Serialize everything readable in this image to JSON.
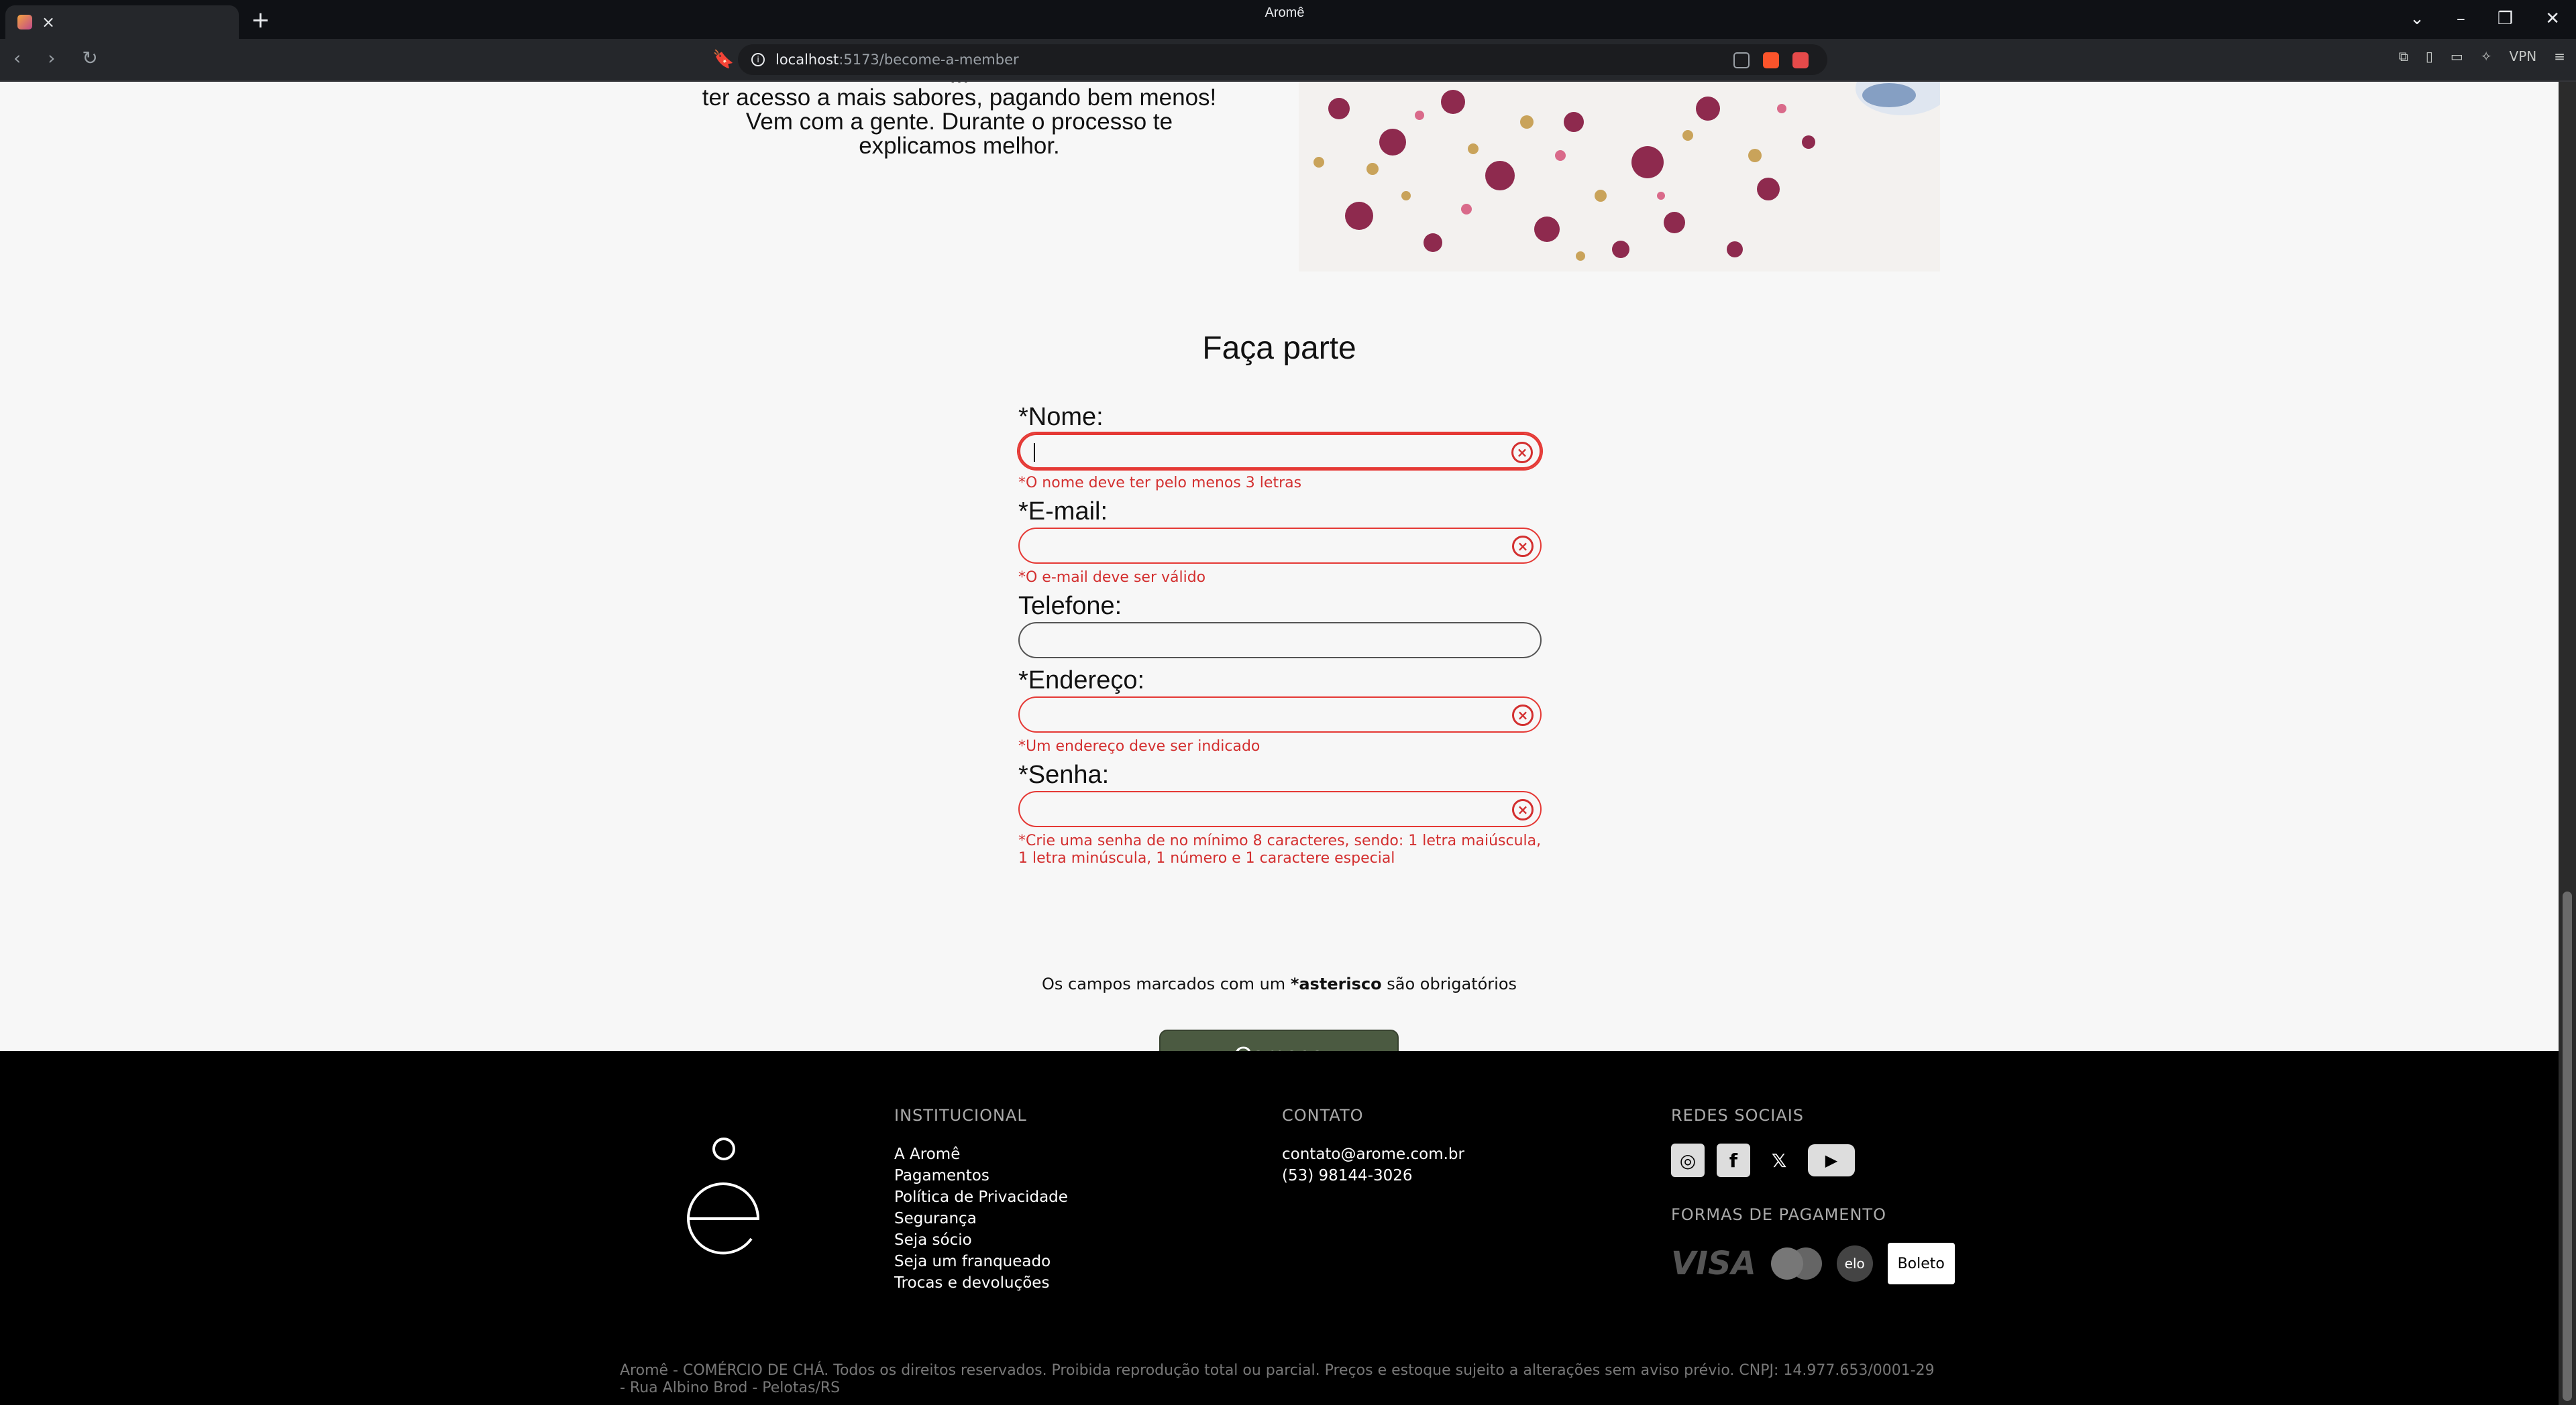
{
  "browser": {
    "tab_title": "Aromê",
    "url_host": "localhost",
    "url_path": ":5173/become-a-member",
    "vpn_label": "VPN"
  },
  "intro": {
    "cut_line": "...",
    "line1": "ter acesso a mais sabores, pagando bem menos!",
    "line2": "Vem com a gente. Durante o processo te",
    "line3": "explicamos melhor."
  },
  "form": {
    "title": "Faça parte",
    "fields": [
      {
        "label": "*Nome:",
        "error": "*O nome deve ter pelo menos 3 letras"
      },
      {
        "label": "*E-mail:",
        "error": "*O e-mail deve ser válido"
      },
      {
        "label": "Telefone:",
        "error": ""
      },
      {
        "label": "*Endereço:",
        "error": "*Um endereço deve ser indicado"
      },
      {
        "label": "*Senha:",
        "error": "*Crie uma senha de no mínimo 8 caracteres, sendo: 1 letra maiúscula, 1 letra minúscula, 1 número e 1 caractere especial"
      }
    ],
    "required_note_pre": "Os campos marcados com um ",
    "required_note_bold": "*asterisco",
    "required_note_post": " são obrigatórios",
    "submit_label": "Comece"
  },
  "footer": {
    "institucional_title": "INSTITUCIONAL",
    "institucional_links": [
      "A Aromê",
      "Pagamentos",
      "Política de Privacidade",
      "Segurança",
      "Seja sócio",
      "Seja um franqueado",
      "Trocas e devoluções"
    ],
    "contato_title": "CONTATO",
    "contato_email": "contato@arome.com.br",
    "contato_phone": "(53) 98144-3026",
    "redes_title": "REDES SOCIAIS",
    "pagamento_title": "FORMAS DE PAGAMENTO",
    "visa": "VISA",
    "elo": "elo",
    "boleto": "Boleto",
    "legal": "Aromê - COMÉRCIO DE CHÁ. Todos os direitos reservados. Proibida reprodução total ou parcial. Preços e estoque sujeito a alterações sem aviso prévio. CNPJ: 14.977.653/0001-29 - Rua Albino Brod - Pelotas/RS"
  },
  "colors": {
    "error": "#d32f2f",
    "button": "#4b5a41",
    "footer_bg": "#000000"
  }
}
